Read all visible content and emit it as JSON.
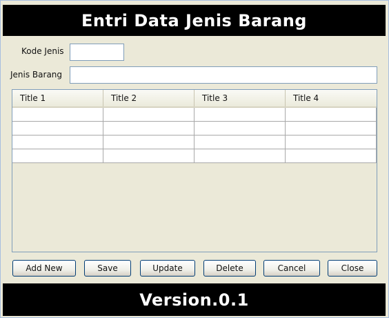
{
  "header": {
    "title": "Entri Data Jenis Barang"
  },
  "form": {
    "kode_jenis": {
      "label": "Kode Jenis",
      "value": ""
    },
    "jenis_barang": {
      "label": "Jenis Barang",
      "value": ""
    }
  },
  "table": {
    "columns": [
      "Title 1",
      "Title 2",
      "Title 3",
      "Title 4"
    ],
    "rows": [
      [
        "",
        "",
        "",
        ""
      ],
      [
        "",
        "",
        "",
        ""
      ],
      [
        "",
        "",
        "",
        ""
      ],
      [
        "",
        "",
        "",
        ""
      ]
    ]
  },
  "buttons": {
    "add_new": "Add New",
    "save": "Save",
    "update": "Update",
    "delete": "Delete",
    "cancel": "Cancel",
    "close": "Close"
  },
  "footer": {
    "version": "Version.0.1"
  },
  "colors": {
    "background": "#ebe9d8",
    "bar": "#000000",
    "bar_text": "#ffffff",
    "border": "#7f9db9"
  }
}
